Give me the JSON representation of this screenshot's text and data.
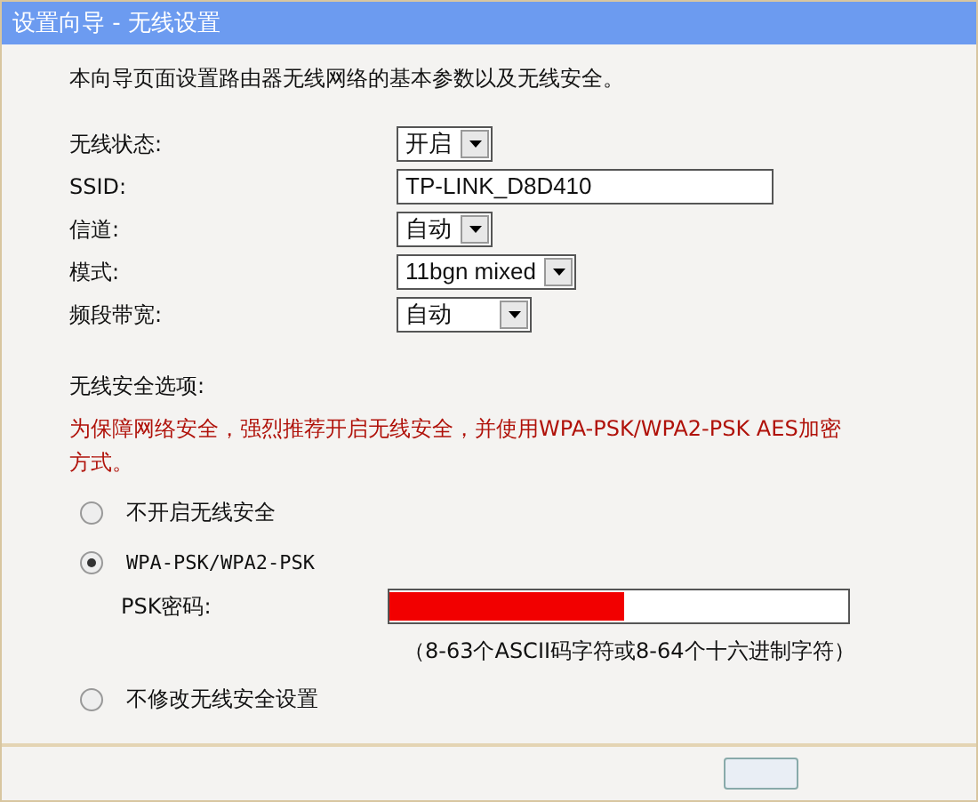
{
  "window": {
    "title": "设置向导 - 无线设置"
  },
  "intro": "本向导页面设置路由器无线网络的基本参数以及无线安全。",
  "fields": [
    {
      "kind": "select",
      "label": "无线状态:",
      "value": "开启"
    },
    {
      "kind": "text",
      "label": "SSID:",
      "value": "TP-LINK_D8D410"
    },
    {
      "kind": "select",
      "label": "信道:",
      "value": "自动"
    },
    {
      "kind": "select",
      "label": "模式:",
      "value": "11bgn mixed"
    },
    {
      "kind": "select",
      "label": "频段带宽:",
      "value": "自动"
    }
  ],
  "security": {
    "heading": "无线安全选项:",
    "warning": "为保障网络安全，强烈推荐开启无线安全，并使用WPA-PSK/WPA2-PSK AES加密方式。",
    "options": [
      {
        "kind": "plain",
        "label": "不开启无线安全",
        "selected": false
      },
      {
        "kind": "wpa",
        "label": "WPA-PSK/WPA2-PSK",
        "selected": true,
        "psk_label": "PSK密码:",
        "psk_redacted": true,
        "psk_hint": "（8-63个ASCII码字符或8-64个十六进制字符）"
      },
      {
        "kind": "plain",
        "label": "不修改无线安全设置",
        "selected": false
      }
    ]
  },
  "footer": {
    "button": true
  }
}
